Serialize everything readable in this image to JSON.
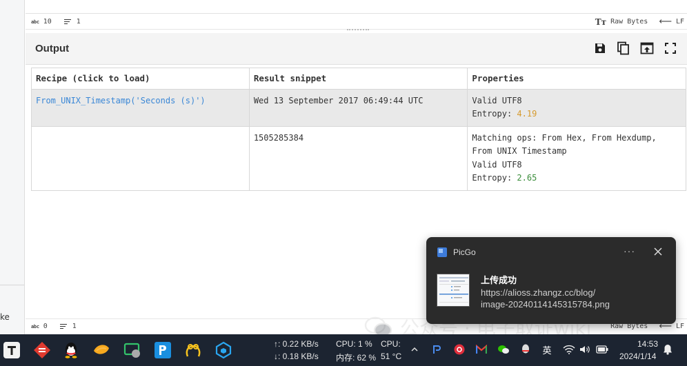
{
  "left_panel": {
    "fragment_text": "ke"
  },
  "status_top": {
    "chars_label": "abc",
    "chars": "10",
    "lines": "1",
    "raw_bytes": "Raw Bytes",
    "line_ending": "LF"
  },
  "status_bottom": {
    "chars_label": "abc",
    "chars": "0",
    "lines": "1",
    "raw_bytes": "Raw Bytes",
    "line_ending": "LF"
  },
  "output": {
    "title": "Output",
    "table": {
      "headers": [
        "Recipe (click to load)",
        "Result snippet",
        "Properties"
      ],
      "rows": [
        {
          "recipe": "From_UNIX_Timestamp('Seconds (s)')",
          "snippet": "Wed 13 September 2017 06:49:44 UTC",
          "properties": [
            "Valid UTF8"
          ],
          "entropy_label": "Entropy: ",
          "entropy": "4.19",
          "entropy_color": "#d69a2d"
        },
        {
          "recipe": "",
          "snippet": "1505285384",
          "properties": [
            "Matching ops: From Hex, From Hexdump,",
            "From UNIX Timestamp",
            "Valid UTF8"
          ],
          "entropy_label": "Entropy: ",
          "entropy": "2.65",
          "entropy_color": "#3a8d3a"
        }
      ]
    }
  },
  "watermark": {
    "text": "公众号 · 电子取证wiki"
  },
  "toast": {
    "app_name": "PicGo",
    "more": "···",
    "title": "上传成功",
    "message_line1": "https://alioss.zhangz.cc/blog/",
    "message_line2": "image-20240114145315784.png"
  },
  "taskbar": {
    "net_up": "↑: 0.22 KB/s",
    "net_down": "↓: 0.18 KB/s",
    "cpu1": "CPU: 1 %",
    "mem": "内存: 62 %",
    "cpu2": "CPU:",
    "temp": "51 °C",
    "ime": "英",
    "time": "14:53",
    "date": "2024/1/14"
  },
  "colors": {
    "accent_link": "#3a87d6",
    "taskbar_bg": "#1c2431",
    "toast_bg": "#2b2b2b"
  }
}
